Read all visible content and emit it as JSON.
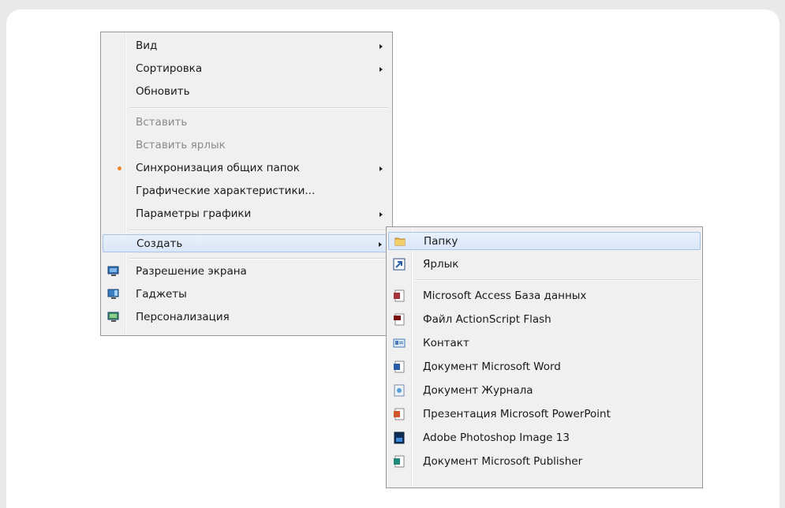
{
  "context_menu": {
    "items": [
      {
        "label": "Вид",
        "submenu": true,
        "disabled": false
      },
      {
        "label": "Сортировка",
        "submenu": true,
        "disabled": false
      },
      {
        "label": "Обновить",
        "submenu": false,
        "disabled": false
      },
      {
        "label": "Вставить",
        "submenu": false,
        "disabled": true
      },
      {
        "label": "Вставить ярлык",
        "submenu": false,
        "disabled": true
      },
      {
        "label": "Синхронизация общих папок",
        "submenu": true,
        "disabled": false,
        "icon": "sync-dot-icon"
      },
      {
        "label": "Графические характеристики...",
        "submenu": false,
        "disabled": false
      },
      {
        "label": "Параметры графики",
        "submenu": true,
        "disabled": false
      },
      {
        "label": "Создать",
        "submenu": true,
        "disabled": false,
        "highlighted": true
      },
      {
        "label": "Разрешение экрана",
        "submenu": false,
        "icon": "display-icon"
      },
      {
        "label": "Гаджеты",
        "submenu": false,
        "icon": "gadgets-icon"
      },
      {
        "label": "Персонализация",
        "submenu": false,
        "icon": "personalization-icon"
      }
    ]
  },
  "create_submenu": {
    "items": [
      {
        "label": "Папку",
        "icon": "folder-icon",
        "highlighted": true
      },
      {
        "label": "Ярлык",
        "icon": "shortcut-icon"
      },
      {
        "label": "Microsoft Access База данных",
        "icon": "access-icon"
      },
      {
        "label": "Файл ActionScript Flash",
        "icon": "flash-file-icon"
      },
      {
        "label": "Контакт",
        "icon": "contact-icon"
      },
      {
        "label": "Документ Microsoft Word",
        "icon": "word-icon"
      },
      {
        "label": "Документ Журнала",
        "icon": "journal-icon"
      },
      {
        "label": "Презентация Microsoft PowerPoint",
        "icon": "powerpoint-icon"
      },
      {
        "label": "Adobe Photoshop Image 13",
        "icon": "photoshop-icon"
      },
      {
        "label": "Документ Microsoft Publisher",
        "icon": "publisher-icon"
      }
    ]
  },
  "colors": {
    "menu_bg": "#f0f0f0",
    "highlight": "#dae6f7",
    "disabled_text": "#8a8a8a"
  }
}
